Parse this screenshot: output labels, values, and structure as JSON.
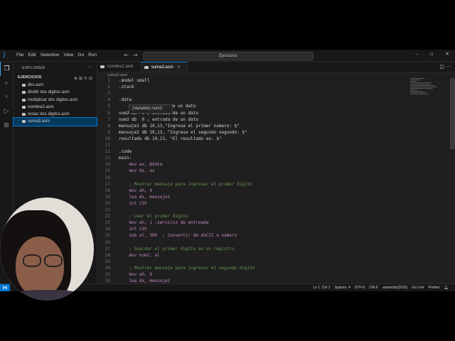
{
  "menu": [
    "File",
    "Edit",
    "Selection",
    "View",
    "Go",
    "Run"
  ],
  "command_center": {
    "text": "Ejercicios"
  },
  "sidebar": {
    "header": "EXPLORER",
    "folder": "EJERCICIOS",
    "files": [
      {
        "name": "divi.asm",
        "selected": false
      },
      {
        "name": "dividir dos digitos.asm",
        "selected": false
      },
      {
        "name": "multiplicar dos digitos.asm",
        "selected": false
      },
      {
        "name": "nombre2.asm",
        "selected": false
      },
      {
        "name": "restar dos digitos.asm",
        "selected": false
      },
      {
        "name": "suma3.asm",
        "selected": true
      }
    ]
  },
  "tabs": [
    {
      "label": "nombre2.asm",
      "active": false
    },
    {
      "label": "suma3.asm",
      "active": true,
      "close": "×"
    }
  ],
  "breadcrumb": "suma3.asm",
  "hover_tooltip": {
    "kind": "(Variable)",
    "name": "num2"
  },
  "code_lines": [
    {
      "n": "1",
      "t": ".model small"
    },
    {
      "n": "2",
      "t": ".stack"
    },
    {
      "n": "3",
      "t": ""
    },
    {
      "n": "4",
      "t": ".data"
    },
    {
      "n": "5",
      "t": "               rada de un dato"
    },
    {
      "n": "6",
      "t": "num2 db  0 ; entrada de un dato"
    },
    {
      "n": "7",
      "t": "num3 db  0 ; entrada de un dato"
    },
    {
      "n": "8",
      "t": "mensaje1 db 10,13,\"Ingrese el primer numero: $\""
    },
    {
      "n": "9",
      "t": "mensaje2 db 10,13, \"Ingrese el segundo segundo: $\""
    },
    {
      "n": "10",
      "t": "resultado db 10,13, \"El resultado es: $\""
    },
    {
      "n": "11",
      "t": ""
    },
    {
      "n": "12",
      "t": ".code"
    },
    {
      "n": "13",
      "t": "main:"
    },
    {
      "n": "14",
      "t": "    mov ax, @data"
    },
    {
      "n": "15",
      "t": "    mov ds, ax"
    },
    {
      "n": "16",
      "t": ""
    },
    {
      "n": "17",
      "t": "    ; Mostrar mensaje para ingresar el primer digito"
    },
    {
      "n": "18",
      "t": "    mov ah, 9"
    },
    {
      "n": "19",
      "t": "    lea dx, mensaje1"
    },
    {
      "n": "20",
      "t": "    int 21h"
    },
    {
      "n": "21",
      "t": ""
    },
    {
      "n": "22",
      "t": "    ; Leer el primer digito"
    },
    {
      "n": "23",
      "t": "    mov ah, 1 ;servicio de entreada"
    },
    {
      "n": "24",
      "t": "    int 21h"
    },
    {
      "n": "25",
      "t": "    sub al, 30h  ; Convertir de ASCII a número"
    },
    {
      "n": "26",
      "t": ""
    },
    {
      "n": "27",
      "t": "    ; Guardar el primer digito en un registro"
    },
    {
      "n": "28",
      "t": "    mov num1, al"
    },
    {
      "n": "29",
      "t": ""
    },
    {
      "n": "30",
      "t": "    ; Mostrar mensaje para ingresar el segundo digito"
    },
    {
      "n": "31",
      "t": "    mov ah, 9"
    },
    {
      "n": "32",
      "t": "    lea dx, mensaje2"
    }
  ],
  "status_bar": {
    "position": "Ln 1, Col 1",
    "spaces": "Spaces: 4",
    "encoding": "UTF-8",
    "eol": "CRLF",
    "language": "assembly(DOS)",
    "golive": "Go Live",
    "prettier": "Prettier"
  },
  "colors": {
    "accent": "#0078d4",
    "selection": "#04395e",
    "keyword": "#c586c0",
    "comment": "#6a9955",
    "string": "#ce9178"
  },
  "icons": [
    "vscode-logo-icon",
    "explorer-icon",
    "search-icon",
    "source-control-icon",
    "run-debug-icon",
    "extensions-icon",
    "bell-icon"
  ]
}
